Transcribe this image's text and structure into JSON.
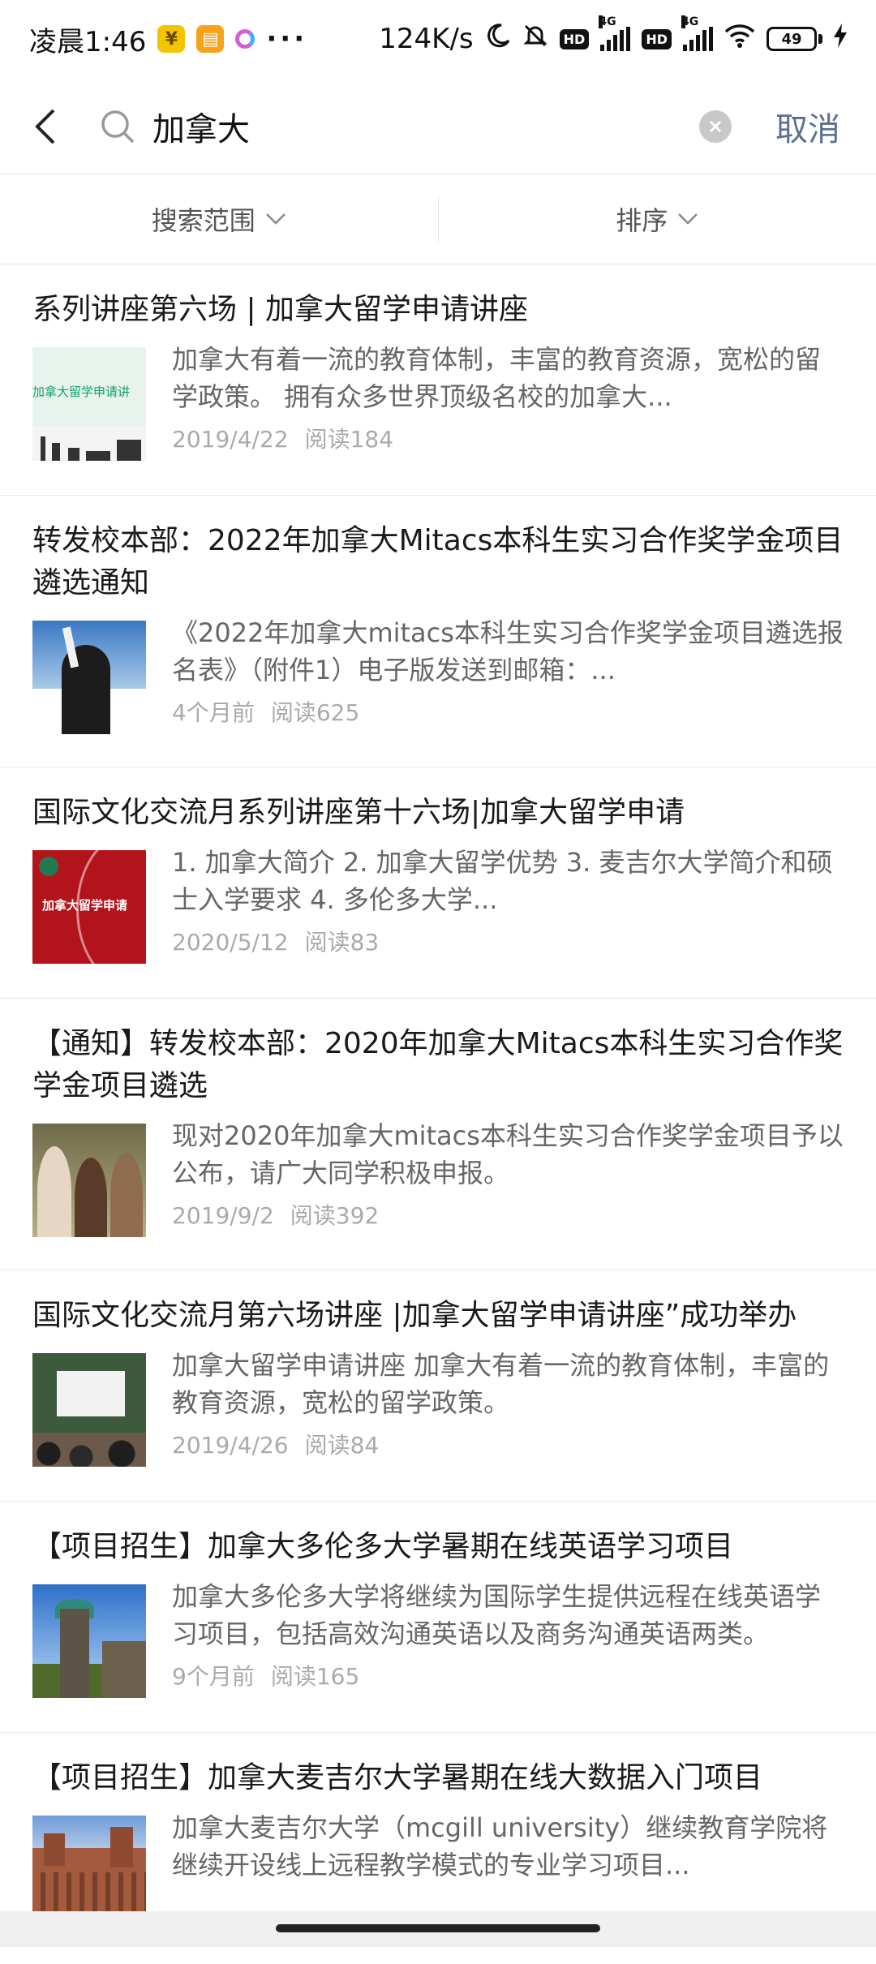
{
  "status_bar": {
    "time": "凌晨1:46",
    "more": "···",
    "net_speed": "124K/s",
    "hd1": "HD",
    "hd2": "HD",
    "net1": "4G",
    "net2": "4G",
    "battery": "49"
  },
  "search": {
    "query": "加拿大",
    "cancel_label": "取消"
  },
  "filters": {
    "scope_label": "搜索范围",
    "sort_label": "排序"
  },
  "results": [
    {
      "title": "系列讲座第六场 | 加拿大留学申请讲座",
      "desc": "加拿大有着一流的教育体制，丰富的教育资源，宽松的留学政策。 拥有众多世界顶级名校的加拿大...",
      "date": "2019/4/22",
      "reads": "阅读184",
      "thumb_text": "加拿大留学申请讲"
    },
    {
      "title": "转发校本部：2022年加拿大Mitacs本科生实习合作奖学金项目遴选通知",
      "desc": "《2022年加拿大mitacs本科生实习合作奖学金项目遴选报名表》（附件1）电子版发送到邮箱：...",
      "date": "4个月前",
      "reads": "阅读625"
    },
    {
      "title": "国际文化交流月系列讲座第十六场|加拿大留学申请",
      "desc": "1. 加拿大简介 2. 加拿大留学优势 3. 麦吉尔大学简介和硕士入学要求 4. 多伦多大学...",
      "date": "2020/5/12",
      "reads": "阅读83",
      "thumb_text": "加拿大留学申请"
    },
    {
      "title": "【通知】转发校本部：2020年加拿大Mitacs本科生实习合作奖学金项目遴选",
      "desc": "现对2020年加拿大mitacs本科生实习合作奖学金项目予以公布，请广大同学积极申报。",
      "date": "2019/9/2",
      "reads": "阅读392"
    },
    {
      "title": "国际文化交流月第六场讲座 |加拿大留学申请讲座”成功举办",
      "desc": "加拿大留学申请讲座 加拿大有着一流的教育体制，丰富的教育资源，宽松的留学政策。",
      "date": "2019/4/26",
      "reads": "阅读84"
    },
    {
      "title": "【项目招生】加拿大多伦多大学暑期在线英语学习项目",
      "desc": "加拿大多伦多大学将继续为国际学生提供远程在线英语学习项目，包括高效沟通英语以及商务沟通英语两类。",
      "date": "9个月前",
      "reads": "阅读165"
    },
    {
      "title": "【项目招生】加拿大麦吉尔大学暑期在线大数据入门项目",
      "desc": "加拿大麦吉尔大学（mcgill university）继续教育学院将继续开设线上远程教学模式的专业学习项目...",
      "date": "",
      "reads": ""
    }
  ]
}
